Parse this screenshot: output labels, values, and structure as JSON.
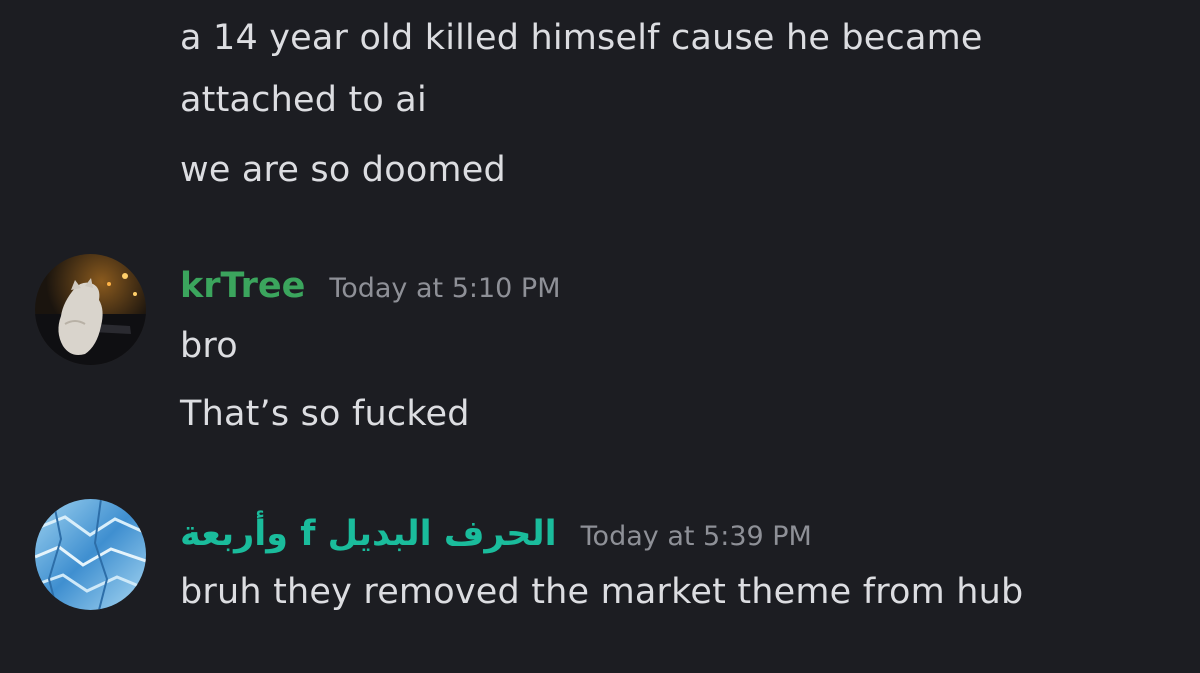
{
  "messages": {
    "continued": {
      "lines": [
        "a 14 year old killed himself cause he became",
        "attached to ai",
        "we are so doomed"
      ]
    },
    "krtree": {
      "username": "krTree",
      "username_color": "#3ba55d",
      "timestamp": "Today at 5:10 PM",
      "lines": [
        "bro",
        "That’s so fucked"
      ]
    },
    "arabic": {
      "username": "الحرف البديل f وأربعة",
      "username_color": "#1abc9c",
      "timestamp": "Today at 5:39 PM",
      "lines": [
        "bruh they removed the market theme from hub"
      ]
    }
  }
}
